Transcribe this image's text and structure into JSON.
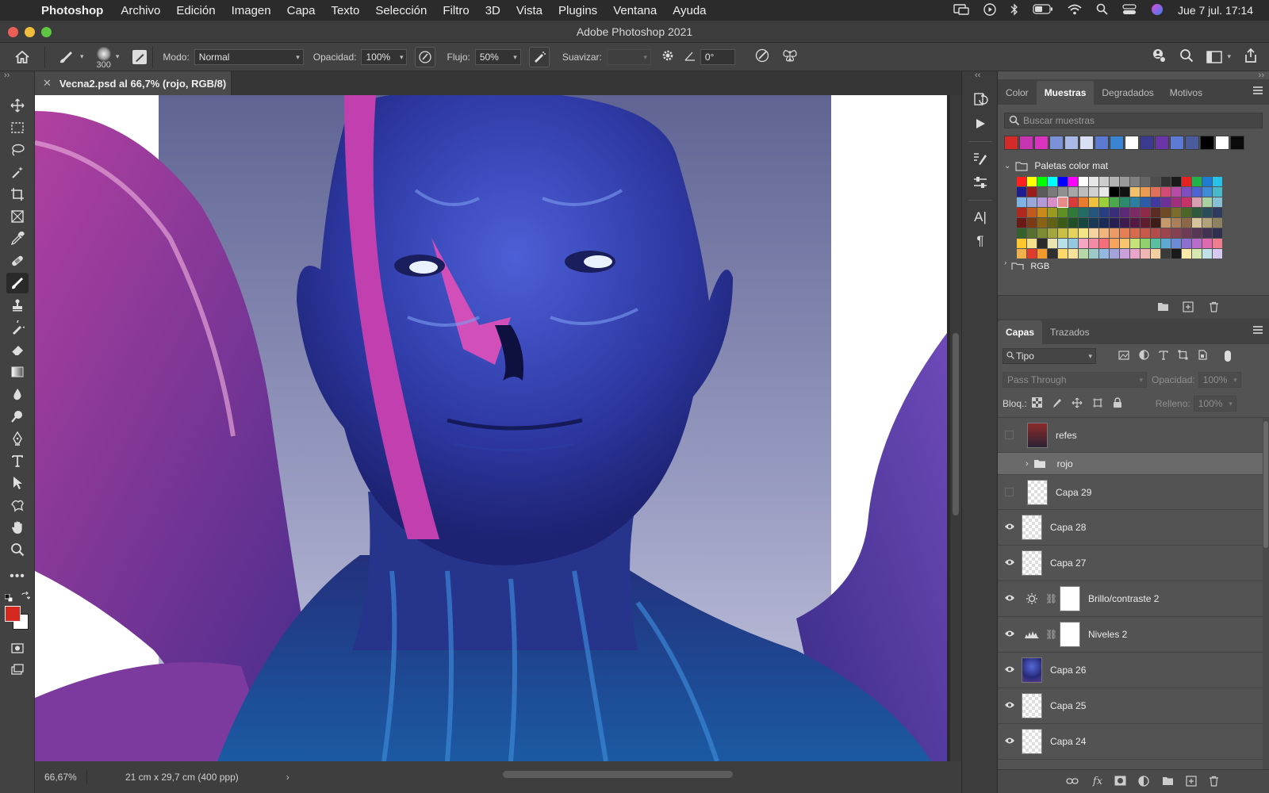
{
  "menubar": {
    "app_name": "Photoshop",
    "items": [
      "Archivo",
      "Edición",
      "Imagen",
      "Capa",
      "Texto",
      "Selección",
      "Filtro",
      "3D",
      "Vista",
      "Plugins",
      "Ventana",
      "Ayuda"
    ],
    "datetime": "Jue 7 jul.  17:14"
  },
  "window": {
    "title": "Adobe Photoshop 2021"
  },
  "options": {
    "brush_size": "300",
    "mode_label": "Modo:",
    "mode_value": "Normal",
    "opacity_label": "Opacidad:",
    "opacity_value": "100%",
    "flow_label": "Flujo:",
    "flow_value": "50%",
    "smoothing_label": "Suavizar:",
    "smoothing_value": "",
    "angle_value": "0°"
  },
  "document": {
    "tab_title": "Vecna2.psd al 66,7% (rojo, RGB/8)",
    "zoom": "66,67%",
    "size_info": "21 cm x 29,7 cm (400 ppp)"
  },
  "colors": {
    "foreground": "#d5281f",
    "background": "#ffffff"
  },
  "swatches_panel": {
    "tabs": [
      "Color",
      "Muestras",
      "Degradados",
      "Motivos"
    ],
    "active_tab": "Muestras",
    "search_placeholder": "Buscar muestras",
    "recent": [
      "#d42a29",
      "#c734b2",
      "#d933c0",
      "#7b92d8",
      "#a9b8e6",
      "#d9e0f4",
      "#5c7ad1",
      "#3a84d3",
      "#ffffff",
      "#3b3c8f",
      "#6a35a8",
      "#5d7ad4",
      "#4a5c9e",
      "#000000",
      "#ffffff",
      "#0a0a0a"
    ],
    "group_name": "Paletas color mat",
    "next_group": "RGB"
  },
  "layers_panel": {
    "tabs": [
      "Capas",
      "Trazados"
    ],
    "active_tab": "Capas",
    "filter_value": "Tipo",
    "blend_mode": "Pass Through",
    "opacity_label": "Opacidad:",
    "opacity_value": "100%",
    "lock_label": "Bloq.:",
    "fill_label": "Relleno:",
    "fill_value": "100%",
    "layers": [
      {
        "name": "refes",
        "visible": false
      },
      {
        "name": "rojo",
        "visible": false
      },
      {
        "name": "Capa 29",
        "visible": false
      },
      {
        "name": "Capa 28",
        "visible": true
      },
      {
        "name": "Capa 27",
        "visible": true
      },
      {
        "name": "Brillo/contraste 2",
        "visible": true
      },
      {
        "name": "Niveles 2",
        "visible": true
      },
      {
        "name": "Capa 26",
        "visible": true
      },
      {
        "name": "Capa 25",
        "visible": true
      },
      {
        "name": "Capa 24",
        "visible": true
      }
    ]
  }
}
